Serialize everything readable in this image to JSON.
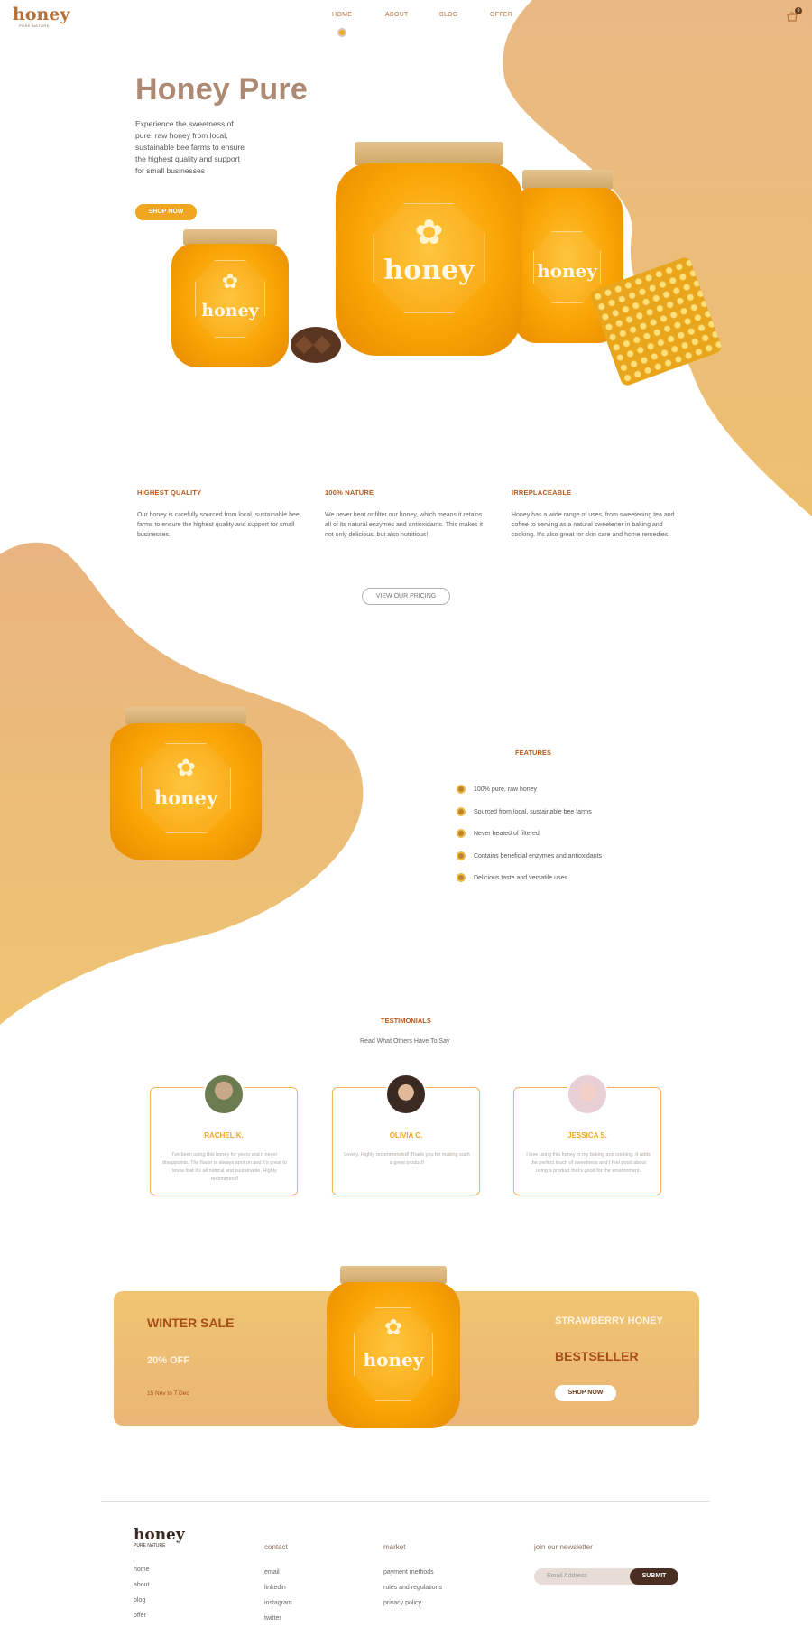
{
  "brand": {
    "logo": "honey",
    "logo_sub": "PURE NATURE"
  },
  "nav": {
    "items": [
      "HOME",
      "ABOUT",
      "BLOG",
      "OFFER"
    ],
    "cart_count": "0"
  },
  "hero": {
    "title": "Honey Pure",
    "text": "Experience the sweetness of pure, raw honey from local, sustainable bee farms to ensure the highest quality and support for small businesses",
    "button": "SHOP NOW",
    "jar_word": "honey"
  },
  "qualities": [
    {
      "title": "HIGHEST QUALITY",
      "text": "Our honey is carefully sourced from local, sustainable bee farms to ensure the highest quality and support for small businesses."
    },
    {
      "title": "100% NATURE",
      "text": "We never heat or filter our honey, which means it retains all of its natural enzymes and antioxidants. This makes it not only delicious, but also nutritious!"
    },
    {
      "title": "IRREPLACEABLE",
      "text": "Honey has a wide range of uses, from sweetening tea and coffee to serving as a natural sweetener in baking and cooking. It's also great for skin care and home remedies."
    }
  ],
  "pricing_button": "VIEW OUR PRICING",
  "features": {
    "title": "FEATURES",
    "items": [
      "100% pure, raw honey",
      "Sourced from local, sustainable bee farms",
      "Never heated of filtered",
      "Contains beneficial enzymes and antioxidants",
      "Delicious taste and versatile uses"
    ]
  },
  "testimonials": {
    "title": "TESTIMONIALS",
    "subtitle": "Read What Others Have To Say",
    "items": [
      {
        "name": "RACHEL K.",
        "text": "I've been using this honey for years and it never disappoints. The flavor is always spot on and it's great to know that it's all natural and sustainable. Highly recommend!"
      },
      {
        "name": "OLIVIA C.",
        "text": "Lovely. Highly recommended! Thank you for making such a great product!"
      },
      {
        "name": "JESSICA S.",
        "text": "I love using this honey in my baking and cooking. It adds the perfect touch of sweetness and I feel good about using a product that's good for the environment."
      }
    ]
  },
  "sale": {
    "title": "WINTER SALE",
    "discount": "20% OFF",
    "dates": "15 Nov to 7 Dec",
    "product": "STRAWBERRY HONEY",
    "badge": "BESTSELLER",
    "button": "SHOP NOW"
  },
  "footer": {
    "logo": "honey",
    "logo_sub": "PURE NATURE",
    "col1": [
      "home",
      "about",
      "blog",
      "offer"
    ],
    "contact": {
      "title": "contact",
      "links": [
        "email",
        "linkedin",
        "instagram",
        "twitter"
      ]
    },
    "market": {
      "title": "market",
      "links": [
        "payment methods",
        "rules and regulations",
        "privacy policy"
      ]
    },
    "newsletter": {
      "title": "join our newsletter",
      "placeholder": "Email Address",
      "button": "SUBMIT"
    }
  },
  "colors": {
    "accent": "#f0a61f",
    "blob": "#ebb97a",
    "heading": "#b55a1e"
  }
}
